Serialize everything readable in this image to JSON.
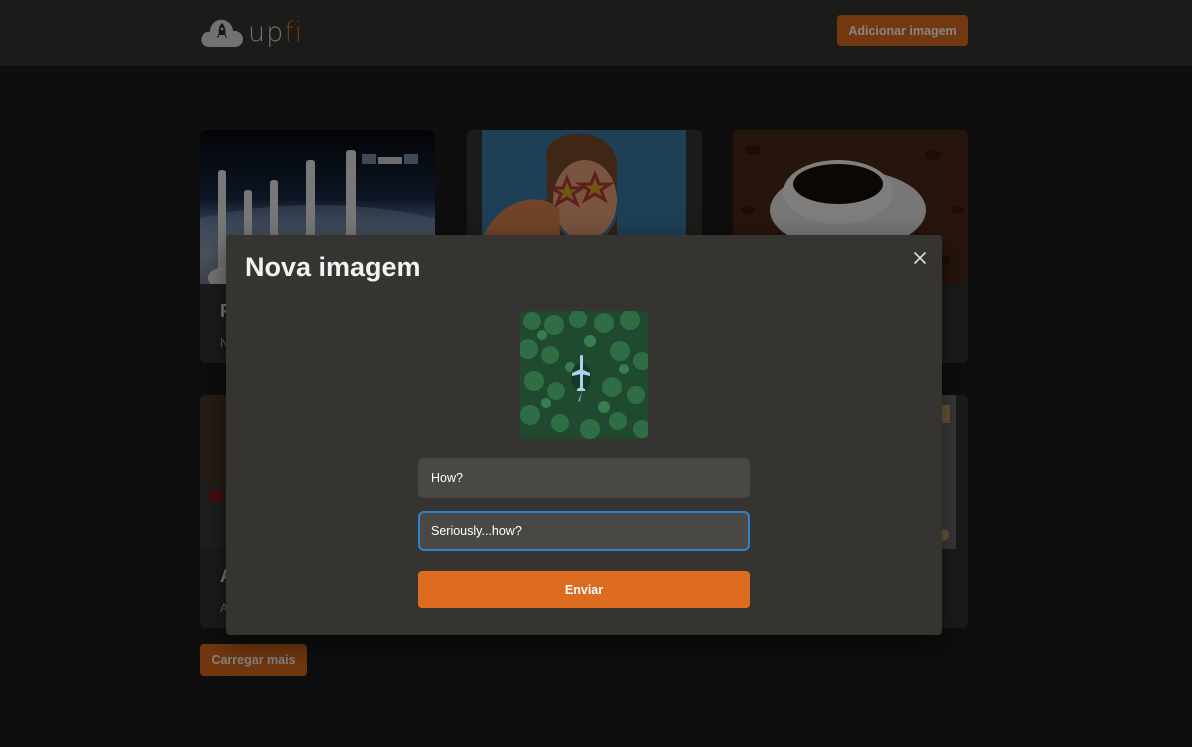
{
  "header": {
    "logo_text_main": "up",
    "logo_text_accent": "fi",
    "add_button_label": "Adicionar imagem"
  },
  "gallery": {
    "cards": [
      {
        "title": "F",
        "description": "N"
      },
      {
        "title": "",
        "description": ""
      },
      {
        "title": "",
        "description": ""
      },
      {
        "title": "A",
        "description": "A"
      },
      {
        "title": "",
        "description": ""
      },
      {
        "title": "",
        "description": ""
      }
    ],
    "load_more_label": "Carregar mais"
  },
  "modal": {
    "title": "Nova imagem",
    "title_field_value": "How?",
    "description_field_value": "Seriously...how?",
    "submit_label": "Enviar"
  },
  "colors": {
    "accent": "#dd6b20",
    "focus_ring": "#3182ce",
    "surface": "#353431",
    "background": "#1b1b1b"
  }
}
